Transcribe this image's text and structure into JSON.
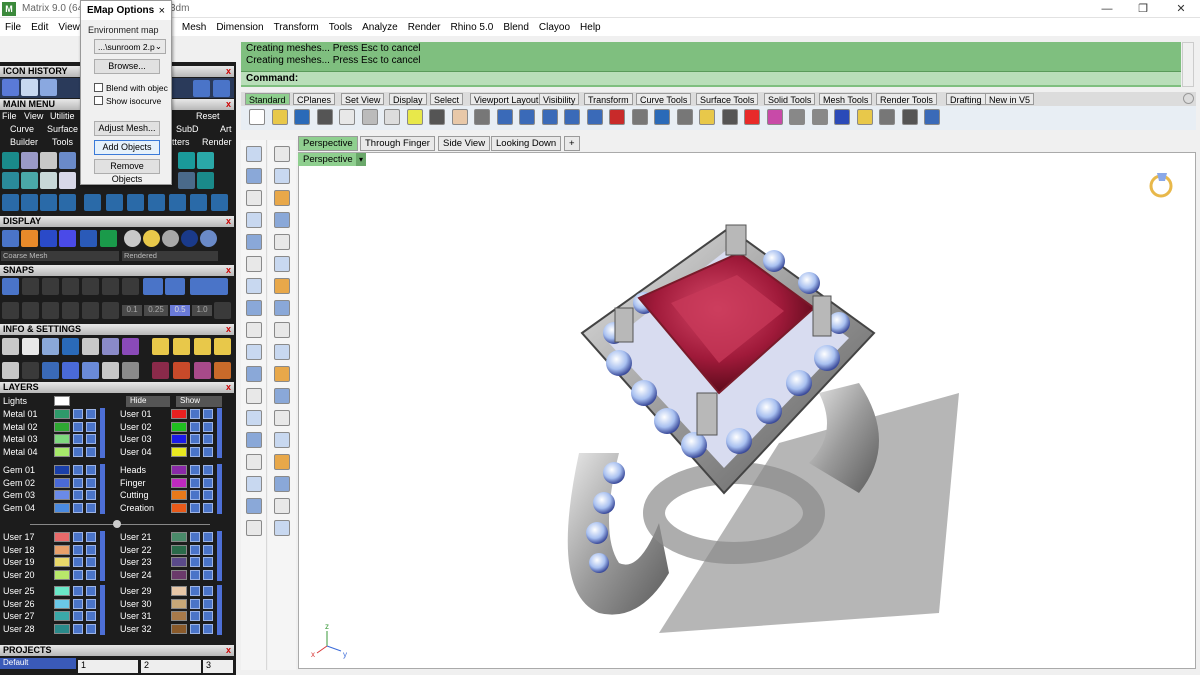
{
  "window": {
    "title": "Matrix 9.0 (64-",
    "title_tail": "3dm",
    "minimize": "—",
    "maximize": "❐",
    "close": "✕"
  },
  "menu": [
    "File",
    "Edit",
    "View",
    "Mesh",
    "Dimension",
    "Transform",
    "Tools",
    "Analyze",
    "Render",
    "Rhino 5.0",
    "Blend",
    "Clayoo",
    "Help"
  ],
  "emap": {
    "title": "EMap Options",
    "close": "×",
    "env_label": "Environment map",
    "env_value": "...\\sunroom 2.p",
    "browse": "Browse...",
    "blend_label": "Blend with objec",
    "isocurve_label": "Show isocurve",
    "adjust_mesh": "Adjust Mesh...",
    "add_objects": "Add Objects",
    "remove_objects": "Remove Objects"
  },
  "left_panel": {
    "icon_history": "ICON HISTORY",
    "main_menu": "MAIN MENU",
    "main_menu_items": [
      "File",
      "View",
      "Utilitie"
    ],
    "reset": "Reset",
    "row2": [
      "Curve",
      "Surface",
      "SubD",
      "Art"
    ],
    "row3": [
      "Builder",
      "Tools",
      "tters",
      "Render"
    ],
    "display": "DISPLAY",
    "display_mode_left": "Coarse Mesh",
    "display_mode_right": "Rendered",
    "snaps": "SNAPS",
    "snap_values": [
      "0.1",
      "0.25",
      "0.5",
      "1.0"
    ],
    "info_settings": "INFO & SETTINGS",
    "layers": "LAYERS",
    "lights": "Lights",
    "hide": "Hide",
    "show": "Show",
    "projects": "PROJECTS",
    "default_project": "Default",
    "page_numbers": [
      "1",
      "2",
      "3"
    ],
    "close_x": "x"
  },
  "layers_left": [
    {
      "name": "Metal 01",
      "color": "#2e9a6a"
    },
    {
      "name": "Metal 02",
      "color": "#2ea832"
    },
    {
      "name": "Metal 03",
      "color": "#7ed87e"
    },
    {
      "name": "Metal 04",
      "color": "#a6e86a"
    },
    {
      "name": "Gem 01",
      "color": "#1a3fa8"
    },
    {
      "name": "Gem 02",
      "color": "#4a6ad8"
    },
    {
      "name": "Gem 03",
      "color": "#6a8ae8"
    },
    {
      "name": "Gem 04",
      "color": "#4a8ae0"
    },
    {
      "name": "User 17",
      "color": "#e86a6a"
    },
    {
      "name": "User 18",
      "color": "#e8a06a"
    },
    {
      "name": "User 19",
      "color": "#e8d86a"
    },
    {
      "name": "User 20",
      "color": "#b8e86a"
    },
    {
      "name": "User 25",
      "color": "#6ae8c8"
    },
    {
      "name": "User 26",
      "color": "#6ac8e8"
    },
    {
      "name": "User 27",
      "color": "#3aa8a8"
    },
    {
      "name": "User 28",
      "color": "#2a8a8a"
    }
  ],
  "layers_right": [
    {
      "name": "User 01",
      "color": "#e82020"
    },
    {
      "name": "User 02",
      "color": "#20c020"
    },
    {
      "name": "User 03",
      "color": "#1a1ae8"
    },
    {
      "name": "User 04",
      "color": "#e8e820"
    },
    {
      "name": "Heads",
      "color": "#8a2aa8"
    },
    {
      "name": "Finger",
      "color": "#c02ac0"
    },
    {
      "name": "Cutting",
      "color": "#e87a1a"
    },
    {
      "name": "Creation",
      "color": "#e85a1a"
    },
    {
      "name": "User 21",
      "color": "#4a8a6a"
    },
    {
      "name": "User 22",
      "color": "#2a6a4a"
    },
    {
      "name": "User 23",
      "color": "#5a4a8a"
    },
    {
      "name": "User 24",
      "color": "#6a3a6a"
    },
    {
      "name": "User 29",
      "color": "#e8c8a8"
    },
    {
      "name": "User 30",
      "color": "#c8a878"
    },
    {
      "name": "User 31",
      "color": "#a87a4a"
    },
    {
      "name": "User 32",
      "color": "#8a5a2a"
    }
  ],
  "command": {
    "line1": "Creating meshes... Press Esc to cancel",
    "line2": "Creating meshes... Press Esc to cancel",
    "prompt": "Command:"
  },
  "toolbar_tabs": [
    "Standard",
    "CPlanes",
    "Set View",
    "Display",
    "Select",
    "Viewport Layout",
    "Visibility",
    "Transform",
    "Curve Tools",
    "Surface Tools",
    "Solid Tools",
    "Mesh Tools",
    "Render Tools",
    "Drafting",
    "New in V5"
  ],
  "viewport_tabs": [
    "Perspective",
    "Through Finger",
    "Side View",
    "Looking Down"
  ],
  "viewport_add": "+",
  "viewport_label": "Perspective",
  "axis": {
    "x": "x",
    "y": "y",
    "z": "z"
  }
}
